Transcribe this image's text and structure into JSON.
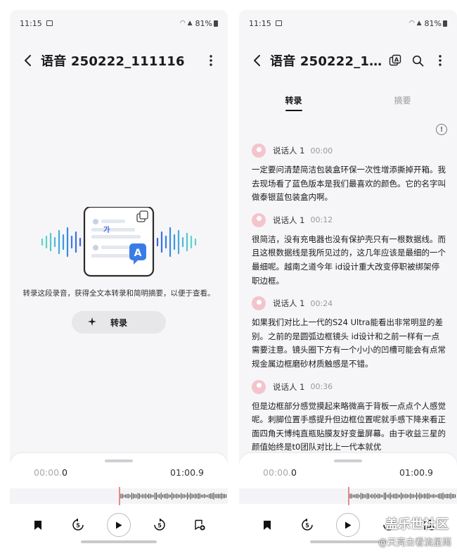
{
  "status": {
    "time": "11:15",
    "battery": "81%"
  },
  "left": {
    "title": "语音 250222_111116",
    "badge_char": "가",
    "badge_letter": "A",
    "prompt": "转录这段录音，获得全文本转录和简明摘要，以便于查看。",
    "transcribe_label": "转录"
  },
  "right": {
    "title": "语音 250222_111...",
    "tabs": [
      {
        "label": "转录",
        "active": true
      },
      {
        "label": "摘要",
        "active": false
      }
    ],
    "segments": [
      {
        "speaker": "说话人 1",
        "time": "00:00",
        "text": "一定要问清楚简洁包装盒环保一次性增添撕掉开箱。我去现场看了蓝色版本是我们最喜欢的颜色。它的名字叫做泰银蓝包装盒内啊。"
      },
      {
        "speaker": "说话人 1",
        "time": "00:12",
        "text": "很简洁，没有充电器也没有保护壳只有一根数据线。而且这根数据线是我所见过的，这几年应该是最细的一个最细呢。越南之道今年 id设计重大改变停职被绑架停职边框。"
      },
      {
        "speaker": "说话人 1",
        "time": "00:24",
        "text": "如果我们对比上一代的S24 Ultra能看出非常明显的差别。之前的是圆弧边框镜头 id设计和之前一样有一点需要注意。镜头圈下方有一个小小的凹槽可能会有点常规金属边框磨砂材质触感是不错。"
      },
      {
        "speaker": "说话人 1",
        "time": "00:36",
        "text": "但是边框部分感觉摸起来略微高于背板一点点个人感觉呢。刺脚位置手感提升但边框位置呢就手感下降来看正面四角天博纯直瓶贴膜友好变量屏幕。由于收益三星的颜值始终是t0团队对比上一代本就优"
      }
    ]
  },
  "player": {
    "current_dim": "00:00.",
    "current_bold": "0",
    "duration": "01:00.9"
  },
  "watermark": {
    "line1": "盖乐世社区",
    "line2": "@天亮去看流星雨"
  }
}
